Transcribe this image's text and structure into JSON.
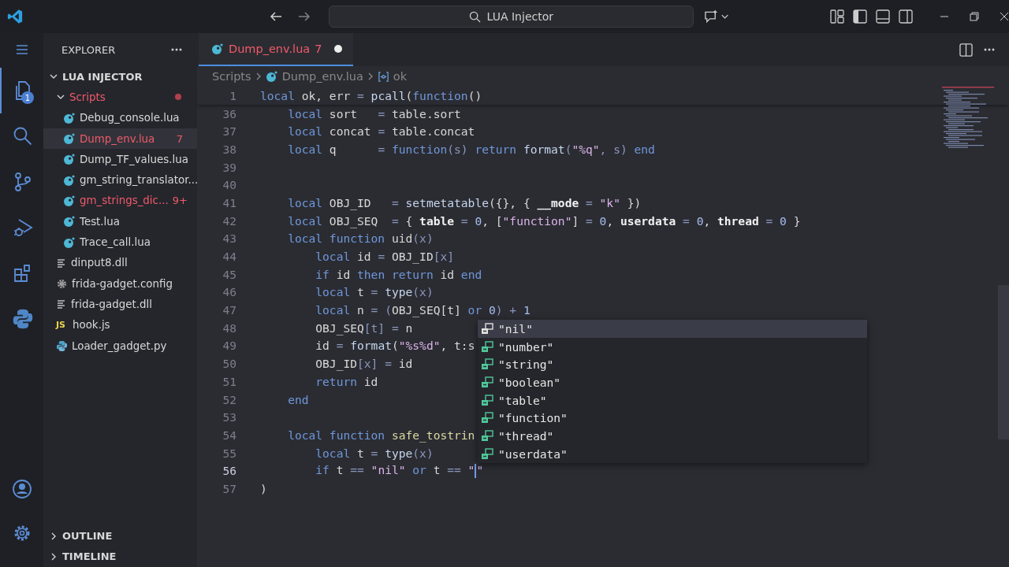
{
  "titlebar": {
    "search": "LUA Injector"
  },
  "activity_bar": {
    "items": [
      {
        "kind": "explorer",
        "selected": true,
        "badge": "1"
      },
      {
        "kind": "search",
        "selected": false
      },
      {
        "kind": "source-control",
        "selected": false
      },
      {
        "kind": "run-debug",
        "selected": false
      },
      {
        "kind": "extensions",
        "selected": false
      },
      {
        "kind": "python",
        "selected": false
      }
    ]
  },
  "sidebar": {
    "title": "EXPLORER",
    "tree": [
      {
        "name": "LUA INJECTOR",
        "kind": "root",
        "expanded": true,
        "children": [
          {
            "name": "Scripts",
            "kind": "folder",
            "expanded": true,
            "errors": true,
            "children": [
              {
                "name": "Debug_console.lua",
                "kind": "lua",
                "selected": false,
                "errors": false
              },
              {
                "name": "Dump_env.lua",
                "kind": "lua",
                "selected": true,
                "errors": true,
                "badge": "7"
              },
              {
                "name": "Dump_TF_values.lua",
                "kind": "lua",
                "selected": false,
                "errors": false
              },
              {
                "name": "gm_string_translator...",
                "kind": "lua",
                "selected": false,
                "errors": false
              },
              {
                "name": "gm_strings_dic...",
                "kind": "lua",
                "selected": false,
                "errors": true,
                "badge": "9+"
              },
              {
                "name": "Test.lua",
                "kind": "lua",
                "selected": false,
                "errors": false
              },
              {
                "name": "Trace_call.lua",
                "kind": "lua",
                "selected": false,
                "errors": false
              }
            ]
          },
          {
            "name": "dinput8.dll",
            "kind": "binary",
            "selected": false,
            "errors": false
          },
          {
            "name": "frida-gadget.config",
            "kind": "config",
            "selected": false,
            "errors": false
          },
          {
            "name": "frida-gadget.dll",
            "kind": "binary",
            "selected": false,
            "errors": false
          },
          {
            "name": "hook.js",
            "kind": "js",
            "icon_text": "JS",
            "selected": false,
            "errors": false
          },
          {
            "name": "Loader_gadget.py",
            "kind": "python",
            "selected": false,
            "errors": false
          }
        ]
      }
    ],
    "sections": [
      {
        "title": "OUTLINE",
        "expanded": false
      },
      {
        "title": "TIMELINE",
        "expanded": false
      }
    ]
  },
  "tab": {
    "label": "Dump_env.lua",
    "badge": "7",
    "modified": true,
    "selected": true
  },
  "breadcrumb": [
    {
      "label": "Scripts",
      "kind": "folder"
    },
    {
      "label": "Dump_env.lua",
      "kind": "lua"
    },
    {
      "label": "ok",
      "kind": "variable"
    }
  ],
  "lines": [
    {
      "number": "1",
      "current": false,
      "tokens": [
        {
          "kind": "kw",
          "text": "local"
        },
        {
          "kind": "text",
          "text": " ok, err "
        },
        {
          "kind": "op",
          "text": "="
        },
        {
          "kind": "fn",
          "text": " pcall"
        },
        {
          "kind": "text",
          "text": "("
        },
        {
          "kind": "kw",
          "text": "function"
        },
        {
          "kind": "text",
          "text": "()"
        }
      ]
    },
    {
      "number": "36",
      "current": false,
      "tokens": [
        {
          "kind": "kw",
          "text": "    local"
        },
        {
          "kind": "text",
          "text": " sort   "
        },
        {
          "kind": "op",
          "text": "="
        },
        {
          "kind": "text",
          "text": " table.sort"
        }
      ]
    },
    {
      "number": "37",
      "current": false,
      "tokens": [
        {
          "kind": "kw",
          "text": "    local"
        },
        {
          "kind": "text",
          "text": " concat "
        },
        {
          "kind": "op",
          "text": "="
        },
        {
          "kind": "text",
          "text": " table.concat"
        }
      ]
    },
    {
      "number": "38",
      "current": false,
      "tokens": [
        {
          "kind": "kw",
          "text": "    local"
        },
        {
          "kind": "text",
          "text": " q      "
        },
        {
          "kind": "op",
          "text": "="
        },
        {
          "kind": "kw",
          "text": " function"
        },
        {
          "kind": "op",
          "text": "(s) "
        },
        {
          "kind": "kw",
          "text": "return"
        },
        {
          "kind": "fn",
          "text": " format"
        },
        {
          "kind": "op",
          "text": "("
        },
        {
          "kind": "str",
          "text": "\"%q\""
        },
        {
          "kind": "op",
          "text": ", s) "
        },
        {
          "kind": "kw",
          "text": "end"
        }
      ]
    },
    {
      "number": "39",
      "current": false
    },
    {
      "number": "40",
      "current": false
    },
    {
      "number": "41",
      "current": false,
      "tokens": [
        {
          "kind": "kw",
          "text": "    local"
        },
        {
          "kind": "text",
          "text": " OBJ_ID   "
        },
        {
          "kind": "op",
          "text": "="
        },
        {
          "kind": "fn",
          "text": " setmetatable"
        },
        {
          "kind": "text",
          "text": "({}, { "
        },
        {
          "kind": "key",
          "text": "__mode"
        },
        {
          "kind": "op",
          "text": " ="
        },
        {
          "kind": "str",
          "text": " \"k\""
        },
        {
          "kind": "text",
          "text": " })"
        }
      ]
    },
    {
      "number": "42",
      "current": false,
      "tokens": [
        {
          "kind": "kw",
          "text": "    local"
        },
        {
          "kind": "text",
          "text": " OBJ_SEQ  "
        },
        {
          "kind": "op",
          "text": "="
        },
        {
          "kind": "text",
          "text": " { "
        },
        {
          "kind": "key",
          "text": "table"
        },
        {
          "kind": "op",
          "text": " ="
        },
        {
          "kind": "num",
          "text": " 0"
        },
        {
          "kind": "text",
          "text": ", ["
        },
        {
          "kind": "str",
          "text": "\"function\""
        },
        {
          "kind": "text",
          "text": "] "
        },
        {
          "kind": "op",
          "text": "="
        },
        {
          "kind": "num",
          "text": " 0"
        },
        {
          "kind": "text",
          "text": ", "
        },
        {
          "kind": "key",
          "text": "userdata"
        },
        {
          "kind": "op",
          "text": " ="
        },
        {
          "kind": "num",
          "text": " 0"
        },
        {
          "kind": "text",
          "text": ", "
        },
        {
          "kind": "key",
          "text": "thread"
        },
        {
          "kind": "op",
          "text": " ="
        },
        {
          "kind": "num",
          "text": " 0"
        },
        {
          "kind": "text",
          "text": " }"
        }
      ]
    },
    {
      "number": "43",
      "current": false,
      "tokens": [
        {
          "kind": "kw",
          "text": "    local"
        },
        {
          "kind": "kw",
          "text": " function"
        },
        {
          "kind": "text",
          "text": " uid"
        },
        {
          "kind": "op",
          "text": "(x)"
        }
      ]
    },
    {
      "number": "44",
      "current": false,
      "tokens": [
        {
          "kind": "kw",
          "text": "        local"
        },
        {
          "kind": "text",
          "text": " id "
        },
        {
          "kind": "op",
          "text": "="
        },
        {
          "kind": "text",
          "text": " OBJ_ID"
        },
        {
          "kind": "op",
          "text": "[x]"
        }
      ]
    },
    {
      "number": "45",
      "current": false,
      "tokens": [
        {
          "kind": "kw",
          "text": "        if"
        },
        {
          "kind": "text",
          "text": " id "
        },
        {
          "kind": "kw",
          "text": "then"
        },
        {
          "kind": "kw",
          "text": " return"
        },
        {
          "kind": "text",
          "text": " id "
        },
        {
          "kind": "kw",
          "text": "end"
        }
      ]
    },
    {
      "number": "46",
      "current": false,
      "tokens": [
        {
          "kind": "kw",
          "text": "        local"
        },
        {
          "kind": "text",
          "text": " t "
        },
        {
          "kind": "op",
          "text": "="
        },
        {
          "kind": "fn",
          "text": " type"
        },
        {
          "kind": "op",
          "text": "(x)"
        }
      ]
    },
    {
      "number": "47",
      "current": false,
      "tokens": [
        {
          "kind": "kw",
          "text": "        local"
        },
        {
          "kind": "text",
          "text": " n "
        },
        {
          "kind": "op",
          "text": "= ("
        },
        {
          "kind": "text",
          "text": "OBJ_SEQ[t] "
        },
        {
          "kind": "kw",
          "text": "or"
        },
        {
          "kind": "num",
          "text": " 0"
        },
        {
          "kind": "op",
          "text": ") + "
        },
        {
          "kind": "num",
          "text": "1"
        }
      ]
    },
    {
      "number": "48",
      "current": false,
      "tokens": [
        {
          "kind": "text",
          "text": "        OBJ_SEQ"
        },
        {
          "kind": "op",
          "text": "[t] ="
        },
        {
          "kind": "text",
          "text": " n"
        }
      ]
    },
    {
      "number": "49",
      "current": false,
      "tokens": [
        {
          "kind": "text",
          "text": "        id "
        },
        {
          "kind": "op",
          "text": "="
        },
        {
          "kind": "fn",
          "text": " format"
        },
        {
          "kind": "text",
          "text": "("
        },
        {
          "kind": "str",
          "text": "\"%s%d\""
        },
        {
          "kind": "text",
          "text": ", t:s"
        }
      ]
    },
    {
      "number": "50",
      "current": false,
      "tokens": [
        {
          "kind": "text",
          "text": "        OBJ_ID"
        },
        {
          "kind": "op",
          "text": "[x] ="
        },
        {
          "kind": "text",
          "text": " id"
        }
      ]
    },
    {
      "number": "51",
      "current": false,
      "tokens": [
        {
          "kind": "kw",
          "text": "        return"
        },
        {
          "kind": "text",
          "text": " id"
        }
      ]
    },
    {
      "number": "52",
      "current": false,
      "tokens": [
        {
          "kind": "kw",
          "text": "    end"
        }
      ]
    },
    {
      "number": "53",
      "current": false
    },
    {
      "number": "54",
      "current": false,
      "tokens": [
        {
          "kind": "kw",
          "text": "    local"
        },
        {
          "kind": "kw",
          "text": " function"
        },
        {
          "kind": "name",
          "text": " safe_tostrin"
        }
      ]
    },
    {
      "number": "55",
      "current": false,
      "tokens": [
        {
          "kind": "kw",
          "text": "        local"
        },
        {
          "kind": "text",
          "text": " t "
        },
        {
          "kind": "op",
          "text": "="
        },
        {
          "kind": "fn",
          "text": " type"
        },
        {
          "kind": "op",
          "text": "(x)"
        }
      ]
    },
    {
      "number": "56",
      "current": true,
      "tokens": [
        {
          "kind": "kw",
          "text": "        if"
        },
        {
          "kind": "text",
          "text": " t "
        },
        {
          "kind": "op",
          "text": "=="
        },
        {
          "kind": "str",
          "text": " \"nil\""
        },
        {
          "kind": "kw",
          "text": " or"
        },
        {
          "kind": "text",
          "text": " t "
        },
        {
          "kind": "op",
          "text": "=="
        },
        {
          "kind": "str",
          "text": " \""
        },
        {
          "kind": "cursor"
        },
        {
          "kind": "str",
          "text": "\""
        }
      ]
    },
    {
      "number": "57",
      "current": false,
      "tokens": [
        {
          "kind": "text",
          "text": ")"
        }
      ]
    }
  ],
  "completions": [
    {
      "label": "\"nil\"",
      "selected": true
    },
    {
      "label": "\"number\"",
      "selected": false
    },
    {
      "label": "\"string\"",
      "selected": false
    },
    {
      "label": "\"boolean\"",
      "selected": false
    },
    {
      "label": "\"table\"",
      "selected": false
    },
    {
      "label": "\"function\"",
      "selected": false
    },
    {
      "label": "\"thread\"",
      "selected": false
    },
    {
      "label": "\"userdata\"",
      "selected": false
    }
  ]
}
